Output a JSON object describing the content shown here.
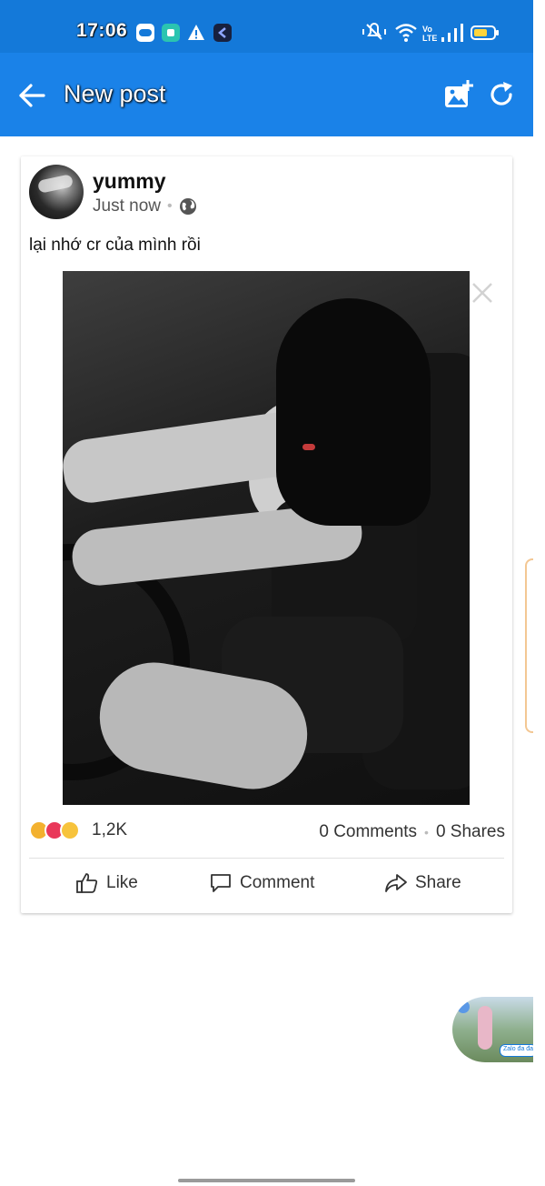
{
  "status_bar": {
    "time": "17:06",
    "notification_icons": [
      "zalo-icon",
      "green-app-icon",
      "warning-icon",
      "dark-app-icon"
    ],
    "system_icons": [
      "mute-vibrate-icon",
      "wifi-icon",
      "volte-icon",
      "signal-icon",
      "battery-icon"
    ],
    "volte_text": "Vo LTE"
  },
  "app_bar": {
    "title": "New post",
    "background_color": "#1a82e8"
  },
  "post": {
    "author": "yummy",
    "time": "Just now",
    "privacy_icon": "globe-icon",
    "text": "lại nhớ cr của mình rồi",
    "reaction_icons": [
      "haha-icon",
      "love-icon",
      "haha-icon"
    ],
    "reaction_count": "1,2K",
    "comments": "0 Comments",
    "shares": "0 Shares",
    "actions": {
      "like": "Like",
      "comment": "Comment",
      "share": "Share"
    }
  },
  "chat_head": {
    "label": "Zalo đa đa"
  }
}
